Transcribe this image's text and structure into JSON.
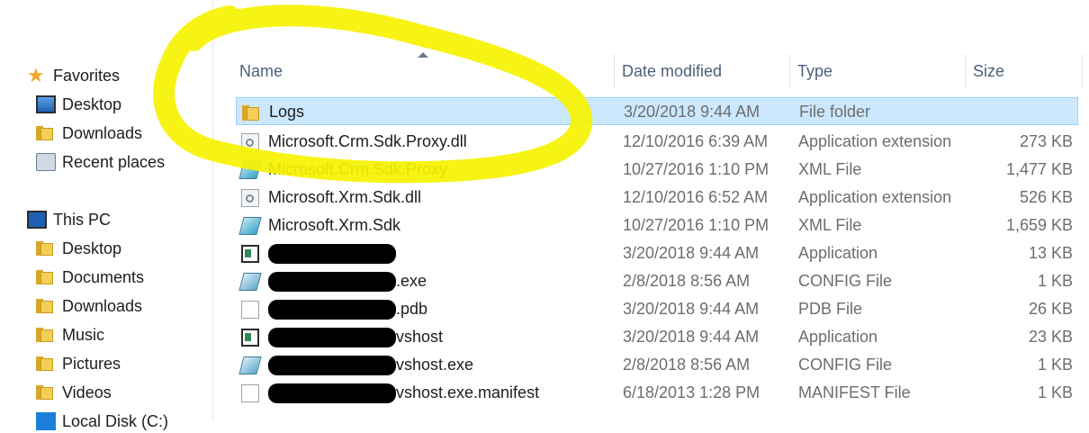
{
  "nav": {
    "favorites": "Favorites",
    "fav_items": [
      "Desktop",
      "Downloads",
      "Recent places"
    ],
    "this_pc": "This PC",
    "pc_items": [
      "Desktop",
      "Documents",
      "Downloads",
      "Music",
      "Pictures",
      "Videos"
    ],
    "partial_drive": "Local Disk (C:)"
  },
  "columns": {
    "name": "Name",
    "date": "Date modified",
    "type": "Type",
    "size": "Size"
  },
  "files": [
    {
      "name": "Logs",
      "date": "3/20/2018 9:44 AM",
      "type": "File folder",
      "size": ""
    },
    {
      "name": "Microsoft.Crm.Sdk.Proxy.dll",
      "date": "12/10/2016 6:39 AM",
      "type": "Application extension",
      "size": "273 KB"
    },
    {
      "name": "Microsoft.Crm.Sdk.Proxy",
      "date": "10/27/2016 1:10 PM",
      "type": "XML File",
      "size": "1,477 KB"
    },
    {
      "name": "Microsoft.Xrm.Sdk.dll",
      "date": "12/10/2016 6:52 AM",
      "type": "Application extension",
      "size": "526 KB"
    },
    {
      "name": "Microsoft.Xrm.Sdk",
      "date": "10/27/2016 1:10 PM",
      "type": "XML File",
      "size": "1,659 KB"
    },
    {
      "name": "",
      "date": "3/20/2018 9:44 AM",
      "type": "Application",
      "size": "13 KB"
    },
    {
      "name": ".exe",
      "date": "2/8/2018 8:56 AM",
      "type": "CONFIG File",
      "size": "1 KB"
    },
    {
      "name": ".pdb",
      "date": "3/20/2018 9:44 AM",
      "type": "PDB File",
      "size": "26 KB"
    },
    {
      "name": "vshost",
      "date": "3/20/2018 9:44 AM",
      "type": "Application",
      "size": "23 KB"
    },
    {
      "name": "vshost.exe",
      "date": "2/8/2018 8:56 AM",
      "type": "CONFIG File",
      "size": "1 KB"
    },
    {
      "name": "vshost.exe.manifest",
      "date": "6/18/2013 1:28 PM",
      "type": "MANIFEST File",
      "size": "1 KB"
    }
  ],
  "colors": {
    "selection": "#cce8ff",
    "highlight": "#f6f200",
    "header_text": "#4c607a"
  }
}
